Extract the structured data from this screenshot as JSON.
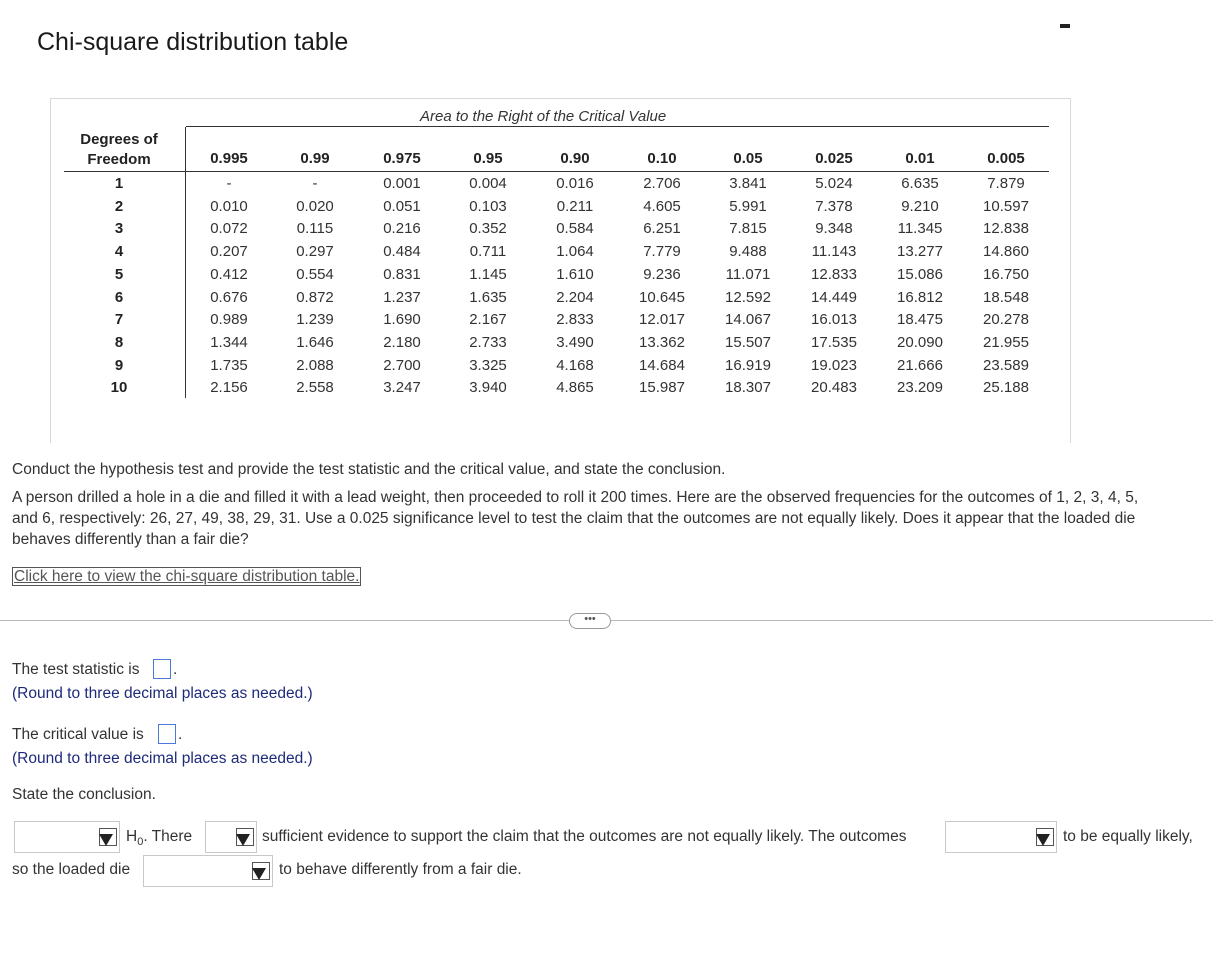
{
  "window": {
    "title": "Chi-square distribution table"
  },
  "table": {
    "caption": "Area to the Right of the Critical Value",
    "df_header_line1": "Degrees of",
    "df_header_line2": "Freedom",
    "columns": [
      "0.995",
      "0.99",
      "0.975",
      "0.95",
      "0.90",
      "0.10",
      "0.05",
      "0.025",
      "0.01",
      "0.005"
    ],
    "rows": [
      {
        "df": "1",
        "values": [
          "-",
          "-",
          "0.001",
          "0.004",
          "0.016",
          "2.706",
          "3.841",
          "5.024",
          "6.635",
          "7.879"
        ]
      },
      {
        "df": "2",
        "values": [
          "0.010",
          "0.020",
          "0.051",
          "0.103",
          "0.211",
          "4.605",
          "5.991",
          "7.378",
          "9.210",
          "10.597"
        ]
      },
      {
        "df": "3",
        "values": [
          "0.072",
          "0.115",
          "0.216",
          "0.352",
          "0.584",
          "6.251",
          "7.815",
          "9.348",
          "11.345",
          "12.838"
        ]
      },
      {
        "df": "4",
        "values": [
          "0.207",
          "0.297",
          "0.484",
          "0.711",
          "1.064",
          "7.779",
          "9.488",
          "11.143",
          "13.277",
          "14.860"
        ]
      },
      {
        "df": "5",
        "values": [
          "0.412",
          "0.554",
          "0.831",
          "1.145",
          "1.610",
          "9.236",
          "11.071",
          "12.833",
          "15.086",
          "16.750"
        ]
      },
      {
        "df": "6",
        "values": [
          "0.676",
          "0.872",
          "1.237",
          "1.635",
          "2.204",
          "10.645",
          "12.592",
          "14.449",
          "16.812",
          "18.548"
        ]
      },
      {
        "df": "7",
        "values": [
          "0.989",
          "1.239",
          "1.690",
          "2.167",
          "2.833",
          "12.017",
          "14.067",
          "16.013",
          "18.475",
          "20.278"
        ]
      },
      {
        "df": "8",
        "values": [
          "1.344",
          "1.646",
          "2.180",
          "2.733",
          "3.490",
          "13.362",
          "15.507",
          "17.535",
          "20.090",
          "21.955"
        ]
      },
      {
        "df": "9",
        "values": [
          "1.735",
          "2.088",
          "2.700",
          "3.325",
          "4.168",
          "14.684",
          "16.919",
          "19.023",
          "21.666",
          "23.589"
        ]
      },
      {
        "df": "10",
        "values": [
          "2.156",
          "2.558",
          "3.247",
          "3.940",
          "4.865",
          "15.987",
          "18.307",
          "20.483",
          "23.209",
          "25.188"
        ]
      }
    ]
  },
  "question": {
    "instruction": "Conduct the hypothesis test and provide the test statistic and the critical value, and state the conclusion.",
    "body_line1": "A person drilled a hole in a die and filled it with a lead weight, then proceeded to roll it 200 times. Here are the observed frequencies for the outcomes of 1, 2, 3, 4, 5,",
    "body_line2": "and 6, respectively: 26, 27, 49, 38, 29, 31. Use a 0.025 significance level to test the claim that the outcomes are not equally likely. Does it appear that the loaded die",
    "body_line3": "behaves differently than a fair die?",
    "link_text": "Click here to view the chi-square distribution table.",
    "more_label": "•••"
  },
  "answers": {
    "test_stat_label": "The test statistic is",
    "test_stat_value": "",
    "round_hint": "(Round to three decimal places as needed.)",
    "critical_label": "The critical value is",
    "critical_value": "",
    "conclusion_label": "State the conclusion.",
    "h0_prefix": "H",
    "h0_sub": "0",
    "there_text": ". There",
    "sufficient_text": "sufficient evidence to support the claim that the outcomes are not equally likely. The outcomes",
    "equally_text": "to be equally likely,",
    "so_text": "so the loaded die",
    "behave_text": "to behave differently from a fair die.",
    "period": "."
  }
}
